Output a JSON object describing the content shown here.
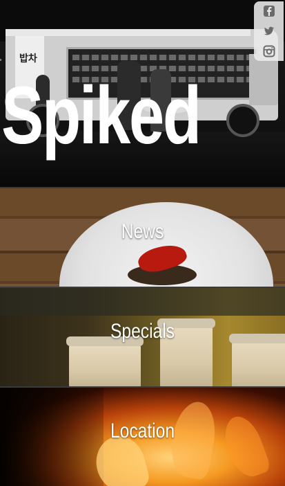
{
  "site": {
    "title": "Spiked"
  },
  "social": {
    "items": [
      {
        "icon": "facebook-icon"
      },
      {
        "icon": "twitter-icon"
      },
      {
        "icon": "instagram-icon"
      }
    ]
  },
  "hero_image": {
    "truck_sign_text": "밥차"
  },
  "nav": {
    "items": [
      {
        "label": "News"
      },
      {
        "label": "Specials"
      },
      {
        "label": "Location"
      }
    ]
  },
  "colors": {
    "title_text": "#ffffff",
    "social_bg": "#ebebeb",
    "social_icon": "#6a6a6a"
  }
}
